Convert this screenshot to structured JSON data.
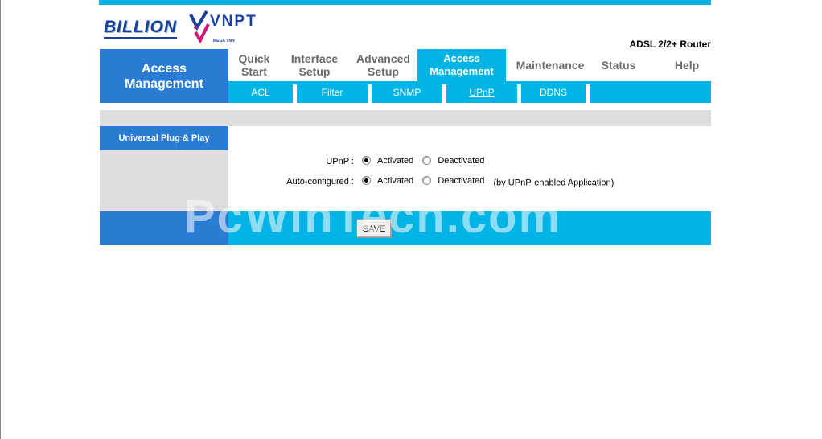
{
  "header": {
    "brand_logo": "BILLION",
    "partner_logo": "VNPT",
    "partner_sub": "MEGA VNN",
    "model": "ADSL 2/2+ Router"
  },
  "nav": {
    "section_title": "Access Management",
    "tabs": [
      {
        "label": "Quick Start"
      },
      {
        "label": "Interface Setup"
      },
      {
        "label": "Advanced Setup"
      },
      {
        "label": "Access Management",
        "active": true
      },
      {
        "label": "Maintenance"
      },
      {
        "label": "Status"
      },
      {
        "label": "Help"
      }
    ],
    "subtabs": [
      {
        "label": "ACL"
      },
      {
        "label": "Filter"
      },
      {
        "label": "SNMP"
      },
      {
        "label": "UPnP",
        "active": true
      },
      {
        "label": "DDNS"
      }
    ]
  },
  "sidebar": {
    "heading": "Universal Plug & Play"
  },
  "form": {
    "upnp": {
      "label": "UPnP :",
      "options": [
        "Activated",
        "Deactivated"
      ],
      "selected": "Activated"
    },
    "auto": {
      "label": "Auto-configured :",
      "options": [
        "Activated",
        "Deactivated"
      ],
      "selected": "Activated",
      "note": "(by UPnP-enabled Application)"
    },
    "save_label": "SAVE"
  },
  "watermark": "PcWinTech.com",
  "colors": {
    "accent": "#00b4e6",
    "primary": "#2a7bd3",
    "panel": "#dedede"
  }
}
